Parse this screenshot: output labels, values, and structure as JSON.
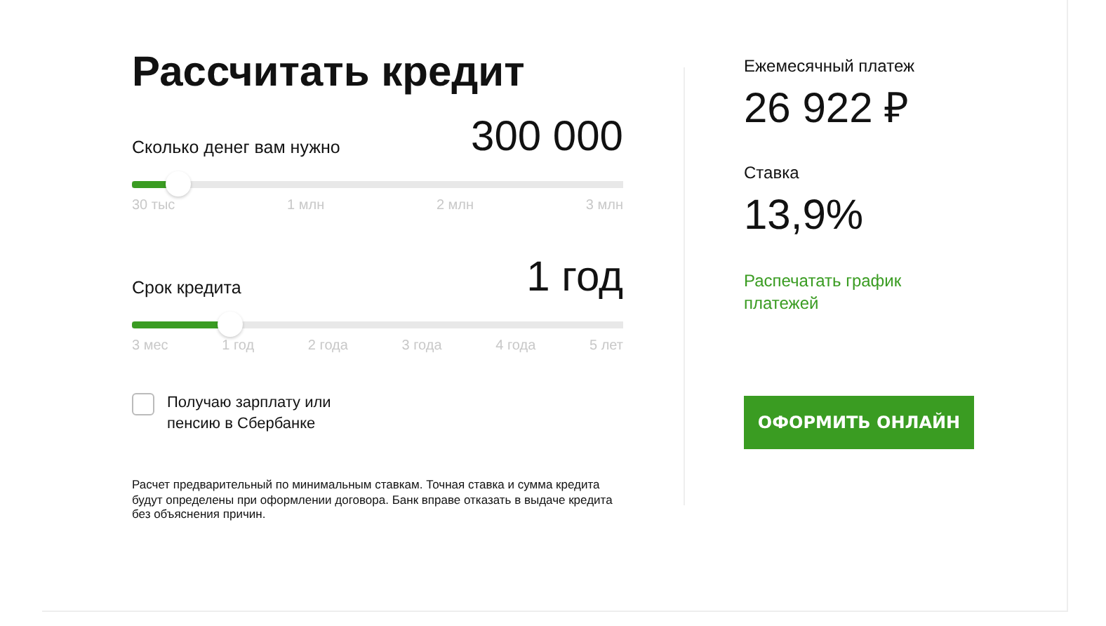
{
  "title": "Рассчитать кредит",
  "sliders": [
    {
      "label": "Сколько денег вам нужно",
      "value": "300 000",
      "level": 0.095,
      "ticks": [
        "30 тыс",
        "1 млн",
        "2 млн",
        "3 млн"
      ]
    },
    {
      "label": "Срок кредита",
      "value": "1 год",
      "level": 0.2,
      "ticks": [
        "3 мес",
        "1 год",
        "2 года",
        "3 года",
        "4 года",
        "5 лет"
      ]
    }
  ],
  "salary_checkbox": {
    "label": "Получаю зарплату или пенсию в Сбербанке",
    "checked": false
  },
  "disclaimer": "Расчет предварительный по минимальным ставкам. Точная ставка и сумма кредита будут определены при оформлении договора. Банк вправе отказать в выдаче кредита без объяснения причин.",
  "results": [
    {
      "label": "Ежемесячный платеж",
      "value": "26 922 ₽"
    },
    {
      "label": "Ставка",
      "value": "13,9%"
    }
  ],
  "print_link": "Распечатать график платежей",
  "apply_button": "ОФОРМИТЬ ОНЛАЙН"
}
